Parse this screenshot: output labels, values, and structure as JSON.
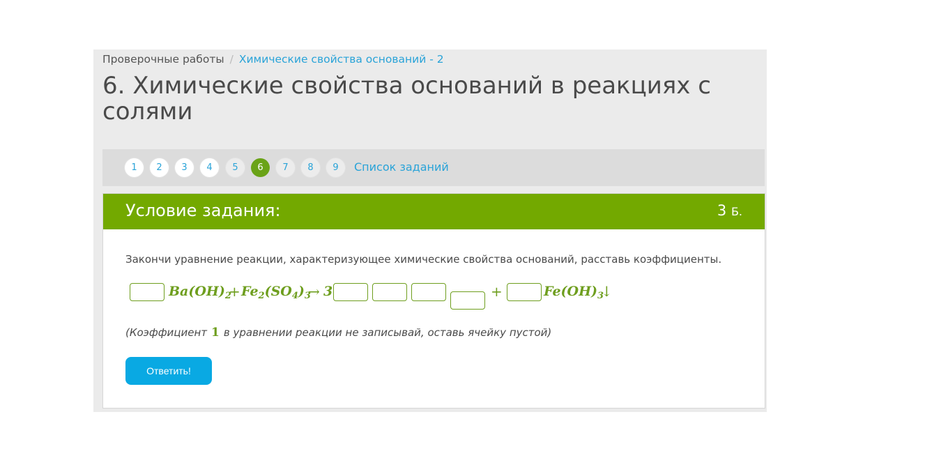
{
  "breadcrumb": {
    "root": "Проверочные работы",
    "separator": "/",
    "current": "Химические свойства оснований - 2"
  },
  "title": "6. Химические свойства оснований в реакциях с солями",
  "pager": {
    "pages": [
      "1",
      "2",
      "3",
      "4",
      "5",
      "6",
      "7",
      "8",
      "9"
    ],
    "active": "6",
    "task_list": "Список заданий"
  },
  "task": {
    "header": "Условие задания:",
    "points": "3",
    "points_unit": "Б.",
    "instruction": "Закончи уравнение реакции, характеризующее химические свойства оснований, расставь коэффициенты.",
    "equation": {
      "reactant1": "Ba(OH)",
      "reactant1_sub": "2",
      "plus": "+",
      "reactant2_a": "Fe",
      "reactant2_sub1": "2",
      "reactant2_b": "(SO",
      "reactant2_sub2": "4",
      "reactant2_c": ")",
      "reactant2_sub3": "3",
      "arrow": "→",
      "product_coef": "3",
      "product2": "Fe(OH)",
      "product2_sub": "3",
      "precipitate": "↓"
    },
    "hint_before": "(Коэффициент",
    "hint_coef": "1",
    "hint_after": "в уравнении реакции не записывай, оставь ячейку пустой)",
    "submit": "Ответить!"
  },
  "colors": {
    "accent_green": "#73a900",
    "link_blue": "#29a3d8",
    "button_blue": "#09a9e3"
  }
}
